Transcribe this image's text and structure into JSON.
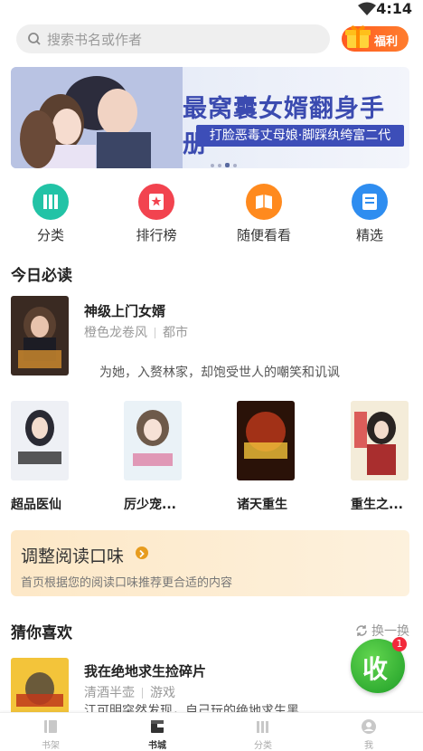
{
  "status_bar": {
    "time": "4:14"
  },
  "search": {
    "placeholder": "搜索书名或作者"
  },
  "welfare": {
    "label": "福利"
  },
  "banner": {
    "title": "最窝囊女婿翻身手册",
    "subtitle": "打脸恶毒丈母娘·脚踩纨绔富二代"
  },
  "quick_nav": [
    {
      "label": "分类",
      "icon": "books-icon",
      "color": "#22c3a6"
    },
    {
      "label": "排行榜",
      "icon": "ranking-icon",
      "color": "#f2434f"
    },
    {
      "label": "随便看看",
      "icon": "browse-icon",
      "color": "#ff8a1e"
    },
    {
      "label": "精选",
      "icon": "featured-icon",
      "color": "#2e8df0"
    }
  ],
  "today": {
    "title": "今日必读",
    "featured": {
      "title": "神级上门女婿",
      "author": "橙色龙卷风",
      "genre": "都市",
      "desc": "为她，入赘林家，却饱受世人的嘲笑和讥讽"
    },
    "books": [
      {
        "name": "超品医仙"
      },
      {
        "name": "厉少宠..."
      },
      {
        "name": "诸天重生"
      },
      {
        "name": "重生之..."
      }
    ]
  },
  "taste": {
    "title": "调整阅读口味",
    "desc": "首页根据您的阅读口味推荐更合适的内容"
  },
  "guess": {
    "title": "猜你喜欢",
    "refresh": "换一换",
    "item": {
      "title": "我在绝地求生捡碎片",
      "author": "清酒半壶",
      "genre": "游戏",
      "desc": "江可明突然发现，自己玩的绝地求生黑…"
    }
  },
  "collect": {
    "label": "收",
    "badge": "1"
  },
  "tabs": [
    {
      "label": "书架"
    },
    {
      "label": "书城"
    },
    {
      "label": "分类"
    },
    {
      "label": "我"
    }
  ]
}
